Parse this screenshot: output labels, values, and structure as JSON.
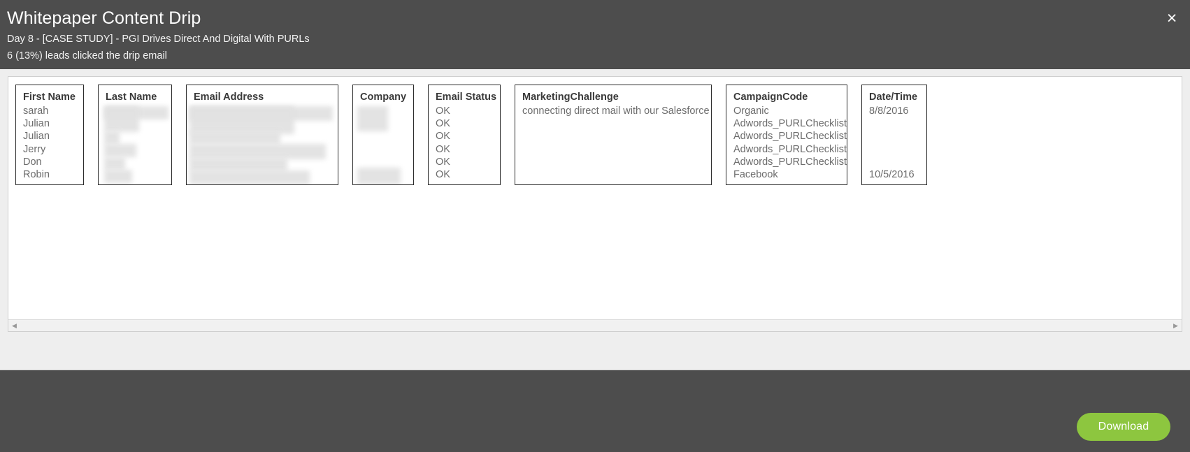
{
  "header": {
    "title": "Whitepaper Content Drip",
    "subtitle": "Day 8 - [CASE STUDY] - PGI Drives Direct And Digital With PURLs",
    "status": "6 (13%) leads clicked the drip email",
    "close_label": "×"
  },
  "table": {
    "columns": [
      {
        "key": "first_name",
        "header": "First Name",
        "redacted": false,
        "values": [
          "sarah",
          "Julian",
          "Julian",
          "Jerry",
          "Don",
          "Robin"
        ]
      },
      {
        "key": "last_name",
        "header": "Last Name",
        "redacted": true,
        "values": [
          "",
          "",
          "",
          "",
          "",
          ""
        ]
      },
      {
        "key": "email_address",
        "header": "Email Address",
        "redacted": true,
        "values": [
          "",
          "",
          "",
          "",
          "",
          ""
        ]
      },
      {
        "key": "company",
        "header": "Company",
        "redacted": true,
        "values": [
          "",
          "",
          "",
          "",
          "",
          ""
        ]
      },
      {
        "key": "email_status",
        "header": "Email Status",
        "redacted": false,
        "values": [
          "OK",
          "OK",
          "OK",
          "OK",
          "OK",
          "OK"
        ]
      },
      {
        "key": "marketing_challenge",
        "header": "MarketingChallenge",
        "redacted": false,
        "values": [
          "connecting direct mail with our Salesforce",
          "",
          "",
          "",
          "",
          ""
        ]
      },
      {
        "key": "campaign_code",
        "header": "CampaignCode",
        "redacted": false,
        "values": [
          "Organic",
          "Adwords_PURLChecklist",
          "Adwords_PURLChecklist",
          "Adwords_PURLChecklist",
          "Adwords_PURLChecklist",
          "Facebook"
        ]
      },
      {
        "key": "date_time",
        "header": "Date/Time",
        "redacted": false,
        "values": [
          "8/8/2016",
          "",
          "",
          "",
          "",
          "10/5/2016"
        ]
      }
    ]
  },
  "scrollbar": {
    "left_arrow": "◀",
    "right_arrow": "▶"
  },
  "footer": {
    "download_label": "Download"
  },
  "colors": {
    "header_bg": "#4d4d4d",
    "body_bg": "#eeeeee",
    "panel_bg": "#ffffff",
    "accent_green": "#8dc63f",
    "column_border": "#2b2b2b",
    "header_text": "#3a3a3a",
    "cell_text": "#6c6c6c"
  }
}
